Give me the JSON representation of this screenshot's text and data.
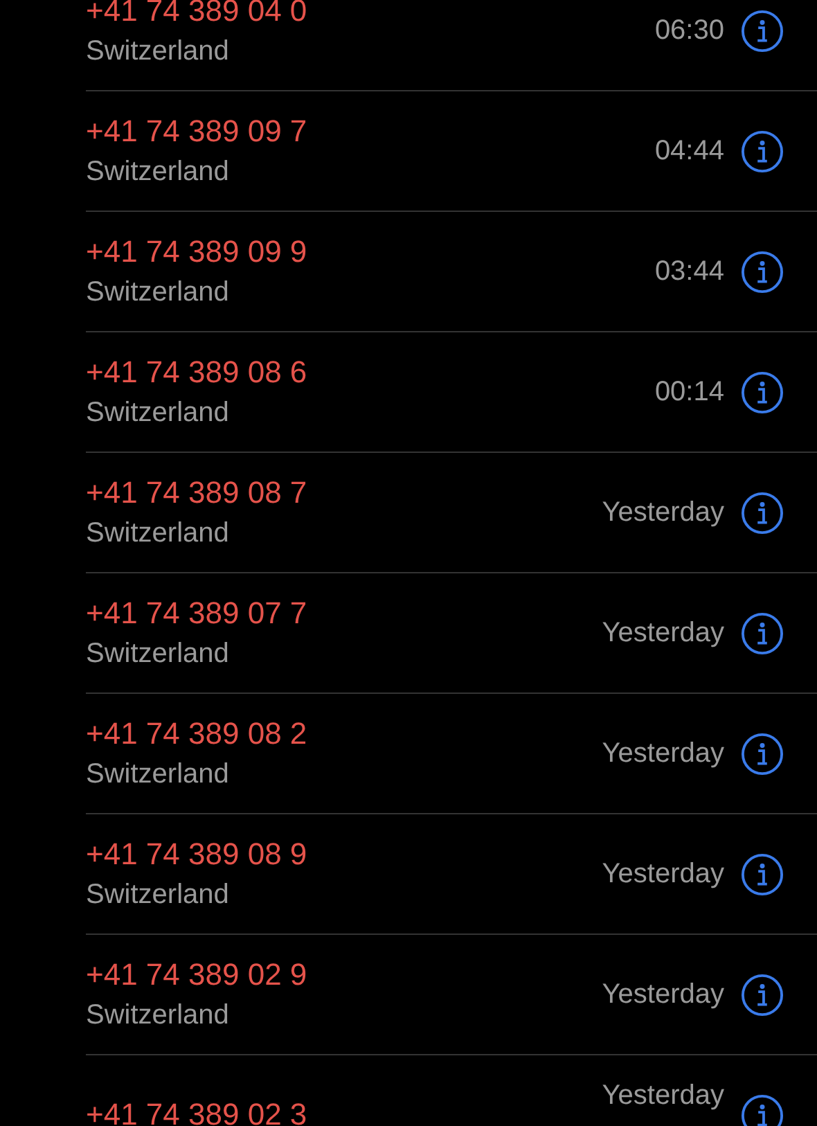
{
  "calls": [
    {
      "number": "+41 74 389 04 0",
      "location": "Switzerland",
      "time": "06:30",
      "missed": true
    },
    {
      "number": "+41 74 389 09 7",
      "location": "Switzerland",
      "time": "04:44",
      "missed": true
    },
    {
      "number": "+41 74 389 09 9",
      "location": "Switzerland",
      "time": "03:44",
      "missed": true
    },
    {
      "number": "+41 74 389 08 6",
      "location": "Switzerland",
      "time": "00:14",
      "missed": true
    },
    {
      "number": "+41 74 389 08 7",
      "location": "Switzerland",
      "time": "Yesterday",
      "missed": true
    },
    {
      "number": "+41 74 389 07 7",
      "location": "Switzerland",
      "time": "Yesterday",
      "missed": true
    },
    {
      "number": "+41 74 389 08 2",
      "location": "Switzerland",
      "time": "Yesterday",
      "missed": true
    },
    {
      "number": "+41 74 389 08 9",
      "location": "Switzerland",
      "time": "Yesterday",
      "missed": true
    },
    {
      "number": "+41 74 389 02 9",
      "location": "Switzerland",
      "time": "Yesterday",
      "missed": true
    },
    {
      "number": "+41 74 389 02 3",
      "time": "Yesterday",
      "missed": true
    }
  ]
}
